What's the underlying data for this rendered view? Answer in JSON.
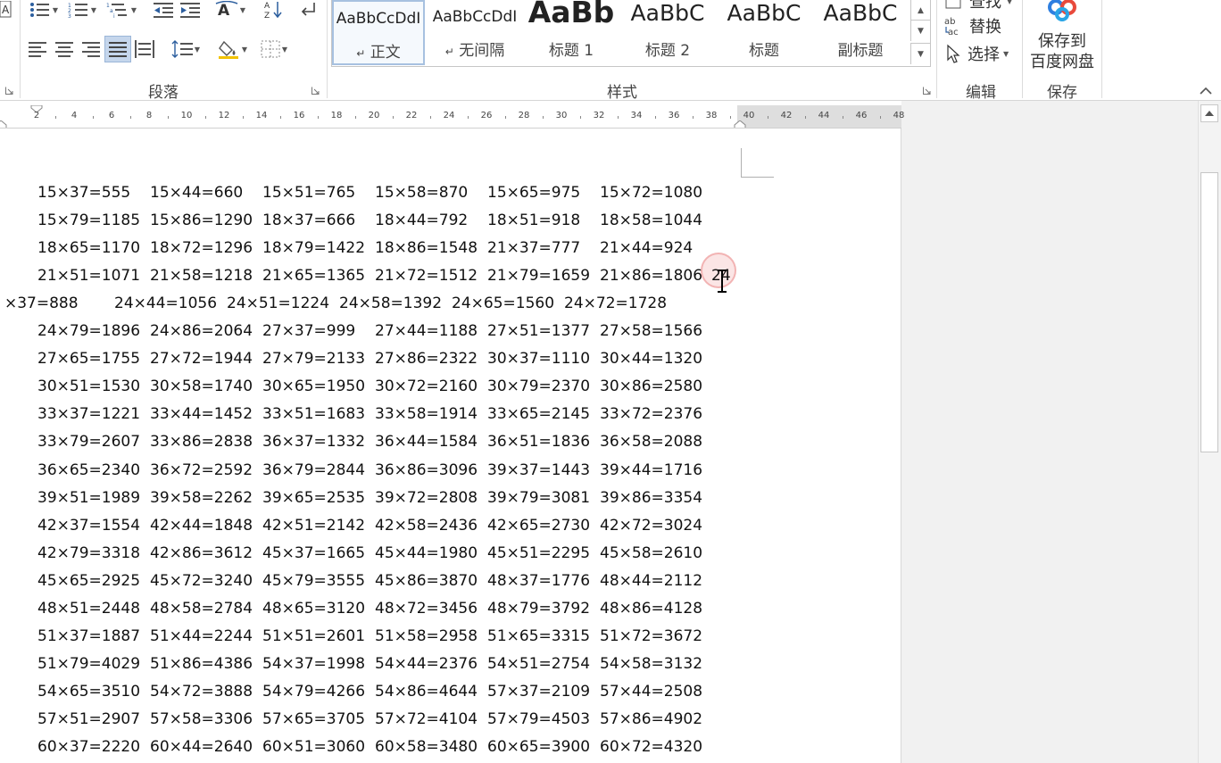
{
  "ribbon": {
    "groups": {
      "paragraph": "段落",
      "styles": "样式",
      "editing": "编辑",
      "save": "保存"
    },
    "styles_gallery": [
      {
        "sample": "AaBbCcDdI",
        "name": "正文",
        "prefix": "↵",
        "selected": true
      },
      {
        "sample": "AaBbCcDdI",
        "name": "无间隔",
        "prefix": "↵",
        "selected": false
      },
      {
        "sample": "AaBb",
        "name": "标题 1",
        "prefix": "",
        "selected": false
      },
      {
        "sample": "AaBbC",
        "name": "标题 2",
        "prefix": "",
        "selected": false
      },
      {
        "sample": "AaBbC",
        "name": "标题",
        "prefix": "",
        "selected": false
      },
      {
        "sample": "AaBbC",
        "name": "副标题",
        "prefix": "",
        "selected": false
      }
    ],
    "editing": {
      "find": "查找",
      "replace": "替换",
      "select": "选择"
    },
    "save_to_cloud": {
      "line1": "保存到",
      "line2": "百度网盘"
    },
    "icons": [
      "bullets-icon",
      "numbering-icon",
      "multilevel-list-icon",
      "decrease-indent-icon",
      "increase-indent-icon",
      "text-direction-icon",
      "sort-icon",
      "show-marks-icon",
      "align-left-icon",
      "center-icon",
      "align-right-icon",
      "justify-icon",
      "distributed-icon",
      "line-spacing-icon",
      "shading-icon",
      "borders-icon"
    ]
  },
  "ruler": {
    "left_numbers": [
      "2",
      "4",
      "6",
      "8",
      "10",
      "12",
      "14",
      "16",
      "18",
      "20",
      "22",
      "24",
      "26",
      "28",
      "30",
      "32",
      "34",
      "36",
      "38"
    ],
    "right_numbers": [
      "40",
      "42",
      "44",
      "46",
      "48"
    ]
  },
  "document": {
    "rows": [
      [
        "15×37=555",
        "15×44=660",
        "15×51=765",
        "15×58=870",
        "15×65=975",
        "15×72=1080"
      ],
      [
        "15×79=1185",
        "15×86=1290",
        "18×37=666",
        "18×44=792",
        "18×51=918",
        "18×58=1044"
      ],
      [
        "18×65=1170",
        "18×72=1296",
        "18×79=1422",
        "18×86=1548",
        "21×37=777",
        "21×44=924"
      ],
      [
        "21×51=1071",
        "21×58=1218",
        "21×65=1365",
        "21×72=1512",
        "21×79=1659",
        "21×86=1806"
      ],
      [
        "×37=888",
        "24×44=1056",
        "24×51=1224",
        "24×58=1392",
        "24×65=1560",
        "24×72=1728"
      ],
      [
        "24×79=1896",
        "24×86=2064",
        "27×37=999",
        "27×44=1188",
        "27×51=1377",
        "27×58=1566"
      ],
      [
        "27×65=1755",
        "27×72=1944",
        "27×79=2133",
        "27×86=2322",
        "30×37=1110",
        "30×44=1320"
      ],
      [
        "30×51=1530",
        "30×58=1740",
        "30×65=1950",
        "30×72=2160",
        "30×79=2370",
        "30×86=2580"
      ],
      [
        "33×37=1221",
        "33×44=1452",
        "33×51=1683",
        "33×58=1914",
        "33×65=2145",
        "33×72=2376"
      ],
      [
        "33×79=2607",
        "33×86=2838",
        "36×37=1332",
        "36×44=1584",
        "36×51=1836",
        "36×58=2088"
      ],
      [
        "36×65=2340",
        "36×72=2592",
        "36×79=2844",
        "36×86=3096",
        "39×37=1443",
        "39×44=1716"
      ],
      [
        "39×51=1989",
        "39×58=2262",
        "39×65=2535",
        "39×72=2808",
        "39×79=3081",
        "39×86=3354"
      ],
      [
        "42×37=1554",
        "42×44=1848",
        "42×51=2142",
        "42×58=2436",
        "42×65=2730",
        "42×72=3024"
      ],
      [
        "42×79=3318",
        "42×86=3612",
        "45×37=1665",
        "45×44=1980",
        "45×51=2295",
        "45×58=2610"
      ],
      [
        "45×65=2925",
        "45×72=3240",
        "45×79=3555",
        "45×86=3870",
        "48×37=1776",
        "48×44=2112"
      ],
      [
        "48×51=2448",
        "48×58=2784",
        "48×65=3120",
        "48×72=3456",
        "48×79=3792",
        "48×86=4128"
      ],
      [
        "51×37=1887",
        "51×44=2244",
        "51×51=2601",
        "51×58=2958",
        "51×65=3315",
        "51×72=3672"
      ],
      [
        "51×79=4029",
        "51×86=4386",
        "54×37=1998",
        "54×44=2376",
        "54×51=2754",
        "54×58=3132"
      ],
      [
        "54×65=3510",
        "54×72=3888",
        "54×79=4266",
        "54×86=4644",
        "57×37=2109",
        "57×44=2508"
      ],
      [
        "57×51=2907",
        "57×58=3306",
        "57×65=3705",
        "57×72=4104",
        "57×79=4503",
        "57×86=4902"
      ],
      [
        "60×37=2220",
        "60×44=2640",
        "60×51=3060",
        "60×58=3480",
        "60×65=3900",
        "60×72=4320"
      ]
    ],
    "caret_text": "24"
  }
}
